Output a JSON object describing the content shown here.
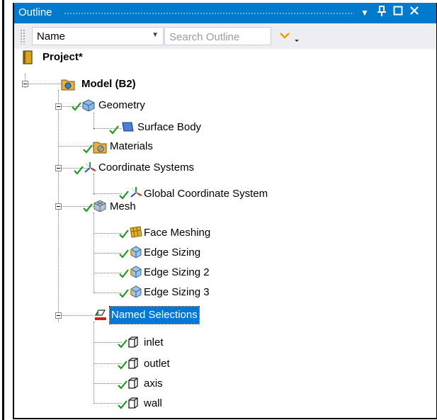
{
  "panel": {
    "title": "Outline",
    "title_buttons": [
      "▾",
      "ᵩ",
      "□",
      "✕"
    ]
  },
  "toolbar": {
    "filter_value": "Name",
    "search_placeholder": "Search Outline"
  },
  "tree": {
    "project": "Project*",
    "model": "Model (B2)",
    "geometry": "Geometry",
    "surface_body": "Surface Body",
    "materials": "Materials",
    "coordinate_systems": "Coordinate Systems",
    "global_coordinate_system": "Global Coordinate System",
    "mesh": "Mesh",
    "face_meshing": "Face Meshing",
    "edge_sizing": "Edge Sizing",
    "edge_sizing_2": "Edge Sizing 2",
    "edge_sizing_3": "Edge Sizing 3",
    "named_selections": "Named Selections",
    "inlet": "inlet",
    "outlet": "outlet",
    "axis": "axis",
    "wall": "wall"
  },
  "colors": {
    "title_bar": "#007acc",
    "selection": "#0078d7",
    "status_check": "#1a9a1a",
    "toolbar_bg": "#eeeef2"
  }
}
